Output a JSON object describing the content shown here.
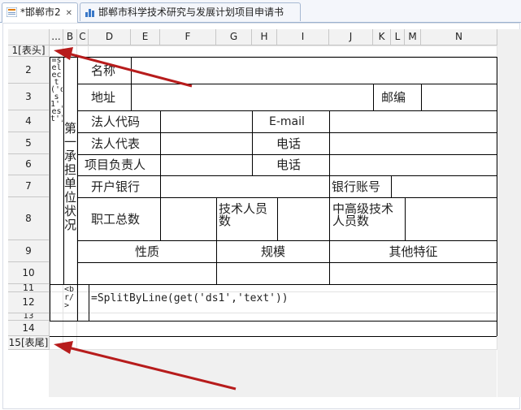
{
  "tabs": [
    {
      "label": "*邯郸市2",
      "active": true
    },
    {
      "label": "邯郸市科学技术研究与发展计划项目申请书",
      "active": false
    }
  ],
  "columns": [
    "...",
    "B",
    "C",
    "D",
    "E",
    "F",
    "G",
    "H",
    "I",
    "J",
    "K",
    "L",
    "M",
    "N"
  ],
  "rows": [
    "1[表头]",
    "2",
    "3",
    "4",
    "5",
    "6",
    "7",
    "8",
    "9",
    "10",
    "11",
    "12",
    "13",
    "14",
    "15[表尾]"
  ],
  "cells": {
    "formula_a": "=select('ds1','test')",
    "section_title": "第一承担单位状况",
    "name": "名称",
    "address": "地址",
    "postcode": "邮编",
    "legal_code": "法人代码",
    "email": "E-mail",
    "legal_rep": "法人代表",
    "phone1": "电话",
    "project_lead": "项目负责人",
    "phone2": "电话",
    "bank": "开户银行",
    "bank_account": "银行账号",
    "staff_total": "职工总数",
    "tech_staff": "技术人员数",
    "senior_tech": "中高级技术人员数",
    "nature": "性质",
    "scale": "规模",
    "other_features": "其他特征",
    "br_formula": "<br/>",
    "split_formula": "=SplitByLine(get('ds1','text'))"
  },
  "colors": {
    "arrow": "#b71c1c",
    "tab_border": "#9bb1cf",
    "header_bg": "#f2f2f2"
  }
}
